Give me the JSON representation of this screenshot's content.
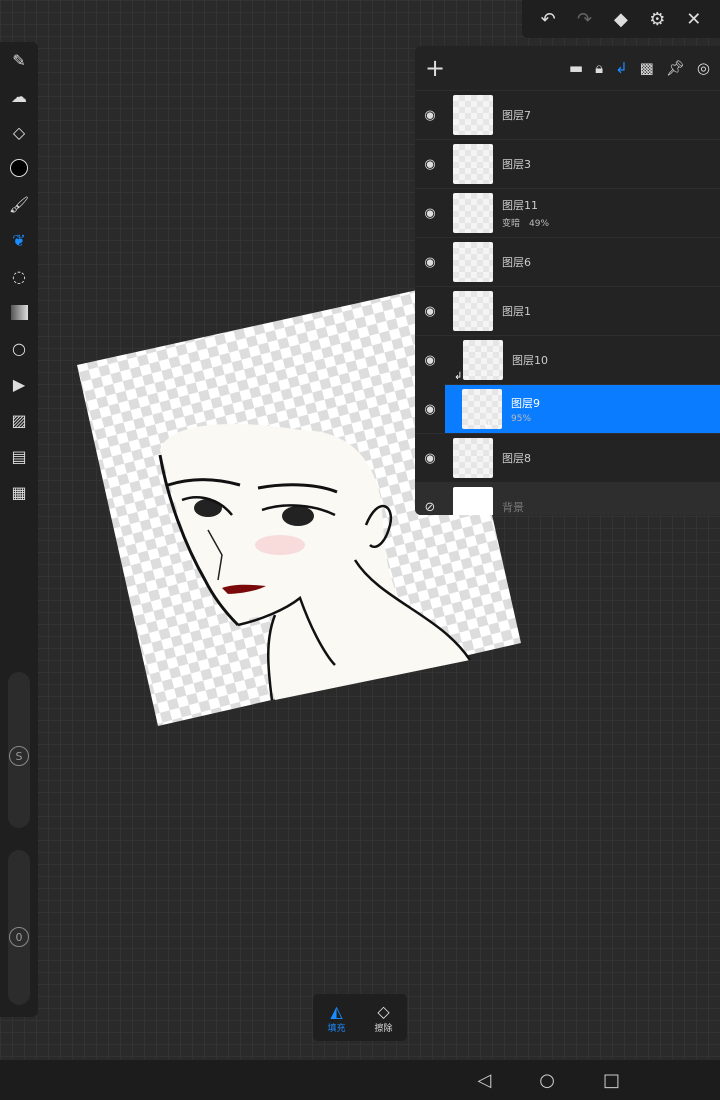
{
  "topbar": {
    "icons": [
      "undo-icon",
      "redo-icon",
      "layers-icon",
      "settings-icon",
      "close-icon"
    ]
  },
  "left_toolbar": {
    "tools": [
      "pencil",
      "smudge",
      "eraser",
      "color",
      "brush-settings",
      "liquify",
      "lasso",
      "gradient",
      "shape",
      "video",
      "import-image",
      "filter",
      "more"
    ],
    "active_tool": "liquify",
    "slider_labels": {
      "size": "S",
      "opacity": "0"
    }
  },
  "layers_panel": {
    "header_icons": [
      "add",
      "folder",
      "lock",
      "clip",
      "alpha-lock",
      "pin",
      "reference"
    ],
    "layers": [
      {
        "name": "图层7",
        "sub": "",
        "visible": true
      },
      {
        "name": "图层3",
        "sub": "",
        "visible": true
      },
      {
        "name": "图层11",
        "sub": "变暗　49%",
        "visible": true
      },
      {
        "name": "图层6",
        "sub": "",
        "visible": true
      },
      {
        "name": "图层1",
        "sub": "",
        "visible": true
      },
      {
        "name": "图层10",
        "sub": "",
        "visible": true,
        "clipped": true
      },
      {
        "name": "图层9",
        "sub": "95%",
        "visible": true,
        "clipped": true,
        "selected": true
      },
      {
        "name": "图层8",
        "sub": "",
        "visible": true
      },
      {
        "name": "背景",
        "sub": "",
        "visible": false
      }
    ]
  },
  "bottom_tools": {
    "fill": "填充",
    "erase": "擦除",
    "active": "fill"
  },
  "colors": {
    "accent": "#0a7cff",
    "panel": "#232323"
  }
}
